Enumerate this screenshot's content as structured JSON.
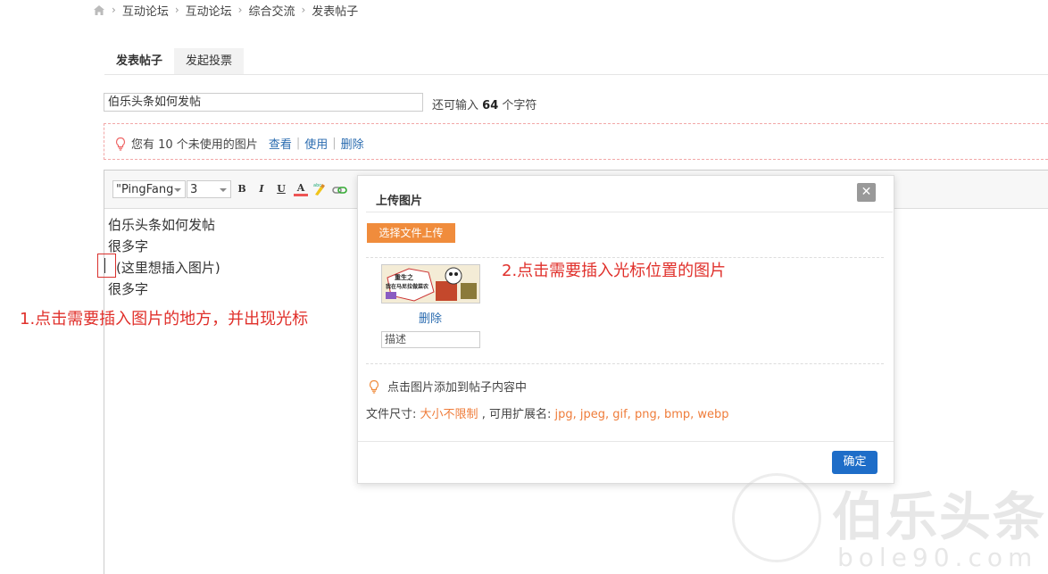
{
  "breadcrumb": {
    "items": [
      "互动论坛",
      "互动论坛",
      "综合交流",
      "发表帖子"
    ]
  },
  "tabs": [
    {
      "label": "发表帖子",
      "active": true
    },
    {
      "label": "发起投票",
      "active": false
    }
  ],
  "title_field": {
    "value": "伯乐头条如何发帖",
    "remaining_prefix": "还可输入",
    "remaining_count": "64",
    "remaining_suffix": "个字符"
  },
  "notice": {
    "text": "您有 10 个未使用的图片",
    "links": [
      "查看",
      "使用",
      "删除"
    ]
  },
  "toolbar": {
    "font_value": "\"PingFang",
    "size_value": "3",
    "buttons": [
      "B",
      "I",
      "U",
      "A"
    ]
  },
  "editor": {
    "lines": [
      "伯乐头条如何发帖",
      "很多字",
      "(这里想插入图片)",
      "很多字"
    ]
  },
  "annotations": {
    "step1": "1.点击需要插入图片的地方，并出现光标",
    "step2": "2.点击需要插入光标位置的图片"
  },
  "dialog": {
    "title": "上传图片",
    "upload_button": "选择文件上传",
    "image_delete": "删除",
    "desc_placeholder": "描述",
    "thumb_text1": "重生之",
    "thumb_text2": "我在马尼拉做菜农",
    "hint": "点击图片添加到帖子内容中",
    "filesize_label": "文件尺寸:",
    "filesize_value": "大小不限制",
    "ext_label": ", 可用扩展名:",
    "ext_value": "jpg, jpeg, gif, png, bmp, webp",
    "confirm": "确定"
  },
  "watermark": {
    "text1": "伯乐头条",
    "text2": "bole90.com"
  },
  "colors": {
    "accent_orange": "#f08c3c",
    "link_blue": "#2b6cb0",
    "annotation_red": "#e0302b",
    "confirm_blue": "#1e6dc8"
  }
}
